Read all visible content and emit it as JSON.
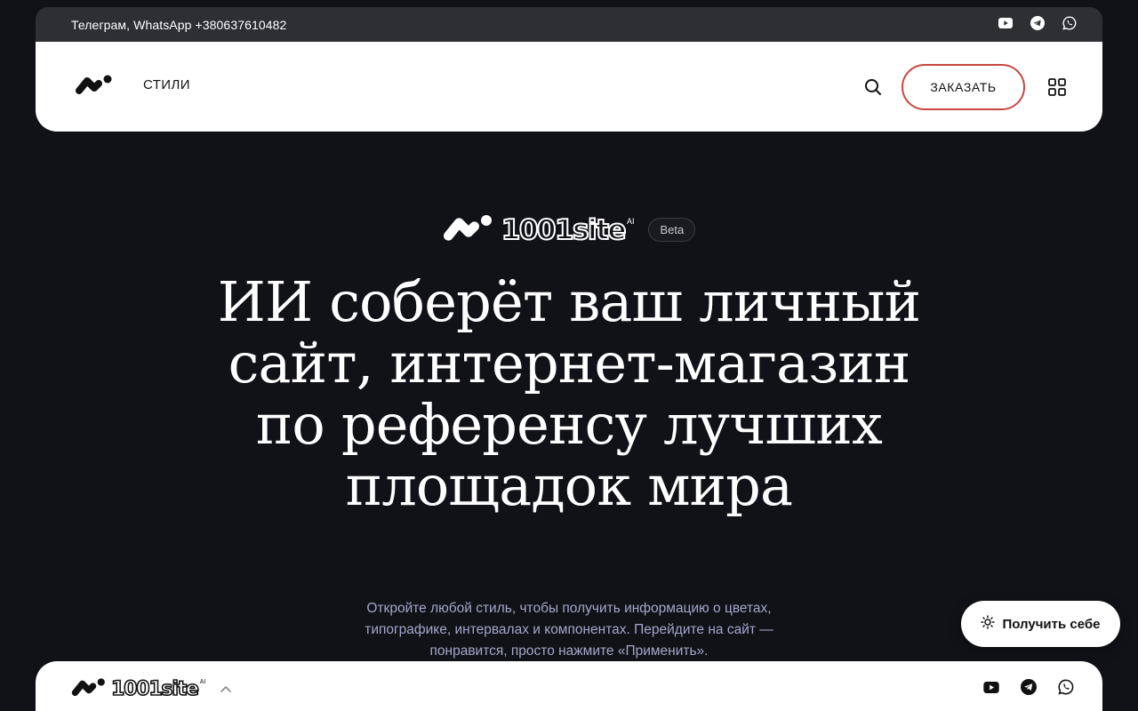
{
  "topbar": {
    "contact": "Телеграм, WhatsApp +380637610482",
    "social_icons": [
      "youtube-icon",
      "telegram-icon",
      "whatsapp-icon"
    ]
  },
  "navbar": {
    "logo_icon": "brand-mark-icon",
    "styles_link": "СТИЛИ",
    "search_icon": "search-icon",
    "order_button": "ЗАКАЗАТЬ",
    "menu_icon": "grid-menu-icon",
    "accent_color": "#c9463f"
  },
  "hero": {
    "brand_name": "1001site",
    "brand_sup": "AI",
    "beta_badge": "Beta",
    "title": "ИИ соберёт ваш личный сайт, интернет-магазин по референсу лучших площадок мира",
    "subtitle": "Откройте любой стиль, чтобы получить информацию о цветах, типографике, интервалах и компонентах. Перейдите на сайт — понравится, просто нажмите «Применить»."
  },
  "floating": {
    "get_button": "Получить себе",
    "get_icon": "sun-icon"
  },
  "bottombar": {
    "brand_name": "1001site",
    "brand_sup": "AI",
    "chevron_icon": "chevron-up-icon",
    "social_icons": [
      "youtube-icon",
      "telegram-icon",
      "whatsapp-icon"
    ]
  },
  "colors": {
    "background": "#111217",
    "subtitle": "#a3a7c9",
    "topbar": "#2e2f33"
  }
}
